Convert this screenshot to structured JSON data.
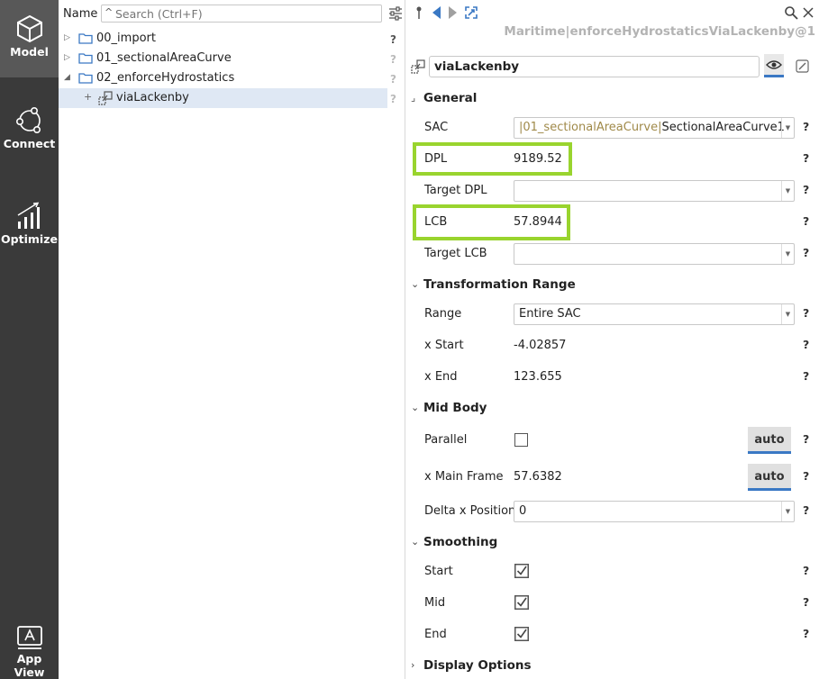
{
  "nav": {
    "items": [
      {
        "label": "Model",
        "icon": "cube-icon",
        "active": true
      },
      {
        "label": "Connect",
        "icon": "connect-nodes-icon",
        "active": false
      },
      {
        "label": "Optimize",
        "icon": "bar-chart-icon",
        "active": false
      },
      {
        "label": "App View",
        "icon": "app-view-icon",
        "active": false
      }
    ]
  },
  "tree": {
    "name_label": "Name",
    "search_placeholder": "Search (Ctrl+F)",
    "items": [
      {
        "label": "00_import",
        "expander": "▷",
        "help": "?"
      },
      {
        "label": "01_sectionalAreaCurve",
        "expander": "▷",
        "help": "?"
      },
      {
        "label": "02_enforceHydrostatics",
        "expander": "◢",
        "help": "?"
      },
      {
        "label": "viaLackenby",
        "expander": "+",
        "help": "?"
      }
    ]
  },
  "props": {
    "breadcrumb": "Maritime|enforceHydrostaticsViaLackenby@1",
    "object_name": "viaLackenby",
    "help": "?",
    "general": {
      "title": "General",
      "sac_label": "SAC",
      "sac_path": "|01_sectionalAreaCurve|",
      "sac_value": "SectionalAreaCurve1",
      "dpl_label": "DPL",
      "dpl_value": "9189.52",
      "target_dpl_label": "Target DPL",
      "lcb_label": "LCB",
      "lcb_value": "57.8944",
      "target_lcb_label": "Target LCB"
    },
    "transformation": {
      "title": "Transformation Range",
      "range_label": "Range",
      "range_value": "Entire SAC",
      "xstart_label": "x Start",
      "xstart_value": "-4.02857",
      "xend_label": "x End",
      "xend_value": "123.655"
    },
    "midbody": {
      "title": "Mid Body",
      "parallel_label": "Parallel",
      "auto_label": "auto",
      "xmain_label": "x Main Frame",
      "xmain_value": "57.6382",
      "delta_label": "Delta x Position",
      "delta_value": "0"
    },
    "smoothing": {
      "title": "Smoothing",
      "start_label": "Start",
      "mid_label": "Mid",
      "end_label": "End"
    },
    "display": {
      "title": "Display Options"
    }
  },
  "colors": {
    "highlight": "#99d42e",
    "accent": "#3a78c4",
    "rail_bg": "#3a3a3a"
  }
}
